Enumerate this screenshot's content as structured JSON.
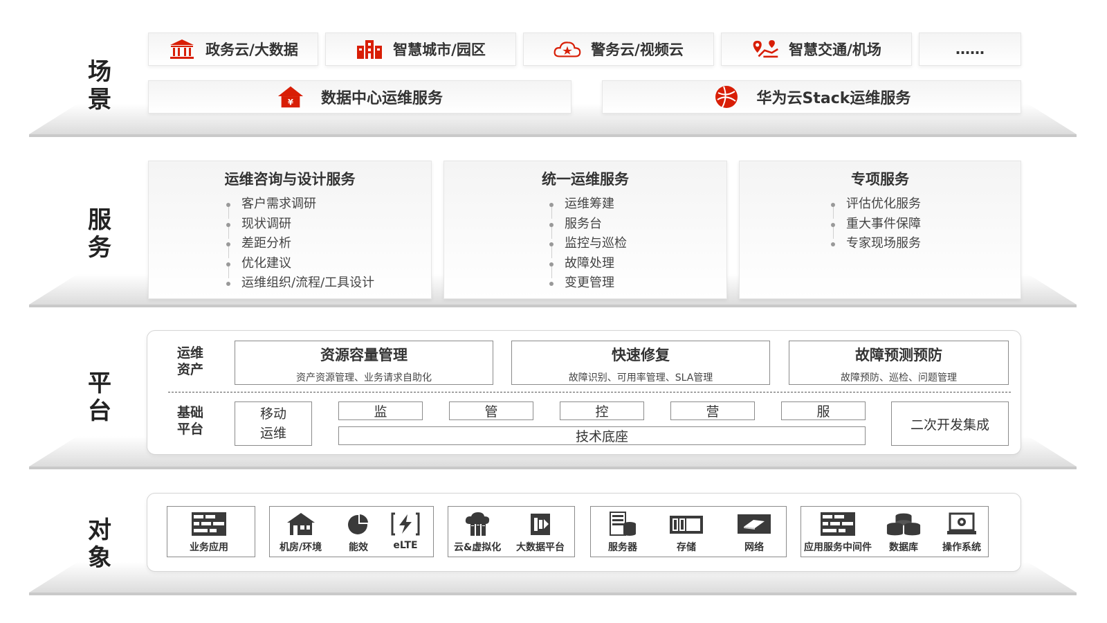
{
  "layers": {
    "scene": [
      "场",
      "景"
    ],
    "service": [
      "服",
      "务"
    ],
    "platform": [
      "平",
      "台"
    ],
    "object": [
      "对",
      "象"
    ]
  },
  "colors": {
    "accent": "#d81e06",
    "icon_dark": "#3a3a3a"
  },
  "scenes": [
    {
      "label": "政务云/大数据",
      "icon": "government-building-icon"
    },
    {
      "label": "智慧城市/园区",
      "icon": "city-buildings-icon"
    },
    {
      "label": "警务云/视频云",
      "icon": "police-cloud-icon"
    },
    {
      "label": "智慧交通/机场",
      "icon": "traffic-location-icon"
    },
    {
      "label": "……",
      "icon": ""
    }
  ],
  "scene_wide": [
    {
      "label": "数据中心运维服务",
      "icon": "datacenter-house-icon"
    },
    {
      "label": "华为云Stack运维服务",
      "icon": "huawei-cloud-stack-icon"
    }
  ],
  "services": [
    {
      "title": "运维咨询与设计服务",
      "items": [
        "客户需求调研",
        "现状调研",
        "差距分析",
        "优化建议",
        "运维组织/流程/工具设计"
      ]
    },
    {
      "title": "统一运维服务",
      "items": [
        "运维筹建",
        "服务台",
        "监控与巡检",
        "故障处理",
        "变更管理"
      ]
    },
    {
      "title": "专项服务",
      "items": [
        "评估优化服务",
        "重大事件保障",
        "专家现场服务"
      ]
    }
  ],
  "platform": {
    "ops_assets_label": "运维\n资产",
    "base_platform_label": "基础\n平台",
    "capabilities": [
      {
        "title": "资源容量管理",
        "sub": "资产资源管理、业务请求自助化"
      },
      {
        "title": "快速修复",
        "sub": "故障识别、可用率管理、SLA管理"
      },
      {
        "title": "故障预测预防",
        "sub": "故障预防、巡检、问题管理"
      }
    ],
    "mobile_ops": "移动\n运维",
    "functions": [
      "监",
      "管",
      "控",
      "营",
      "服"
    ],
    "tech_base": "技术底座",
    "secondary_dev": "二次开发集成"
  },
  "objects": {
    "groups": [
      [
        {
          "label": "业务应用",
          "icon": "business-app-icon"
        }
      ],
      [
        {
          "label": "机房/环境",
          "icon": "machine-room-icon"
        },
        {
          "label": "能效",
          "icon": "energy-efficiency-icon"
        },
        {
          "label": "eLTE",
          "icon": "elte-icon"
        }
      ],
      [
        {
          "label": "云&虚拟化",
          "icon": "cloud-virtualization-icon"
        },
        {
          "label": "大数据平台",
          "icon": "bigdata-platform-icon"
        }
      ],
      [
        {
          "label": "服务器",
          "icon": "server-icon"
        },
        {
          "label": "存储",
          "icon": "storage-icon"
        },
        {
          "label": "网络",
          "icon": "network-icon"
        }
      ],
      [
        {
          "label": "应用服务中间件",
          "icon": "middleware-icon"
        },
        {
          "label": "数据库",
          "icon": "database-icon"
        },
        {
          "label": "操作系统",
          "icon": "operating-system-icon"
        }
      ]
    ]
  }
}
